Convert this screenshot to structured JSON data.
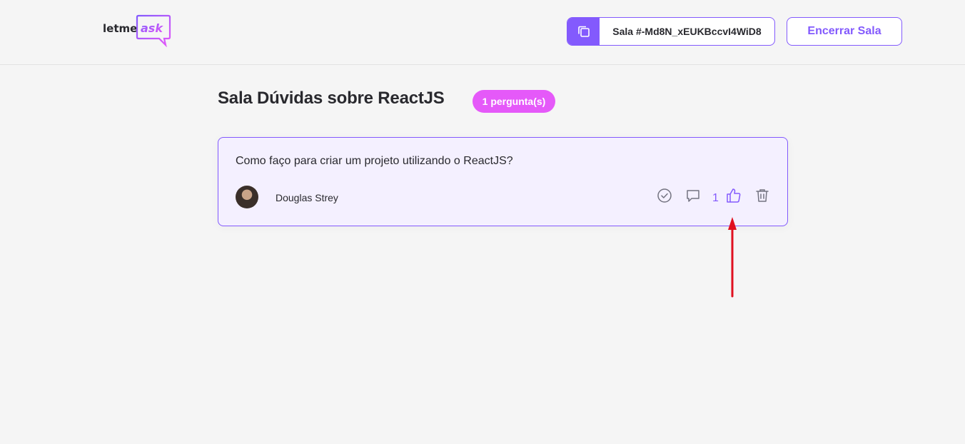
{
  "header": {
    "logo": {
      "text_primary": "letme",
      "text_accent": "ask",
      "icon": "chat-bubble-icon"
    },
    "room_code": {
      "label": "Sala #-Md8N_xEUKBccvI4WiD8",
      "icon": "copy-icon"
    },
    "close_room_label": "Encerrar Sala"
  },
  "room": {
    "title": "Sala Dúvidas sobre ReactJS",
    "question_count": "1 pergunta(s)"
  },
  "questions": [
    {
      "content": "Como faço para criar um projeto utilizando o ReactJS?",
      "author": "Douglas Strey",
      "like_count": "1",
      "actions": [
        "check-circle-icon",
        "answer-icon",
        "like-icon",
        "delete-icon"
      ]
    }
  ],
  "colors": {
    "accent": "#835afd",
    "badge": "#e559f9",
    "card_bg": "#f4f0ff",
    "annotation_arrow": "#e0101f"
  }
}
